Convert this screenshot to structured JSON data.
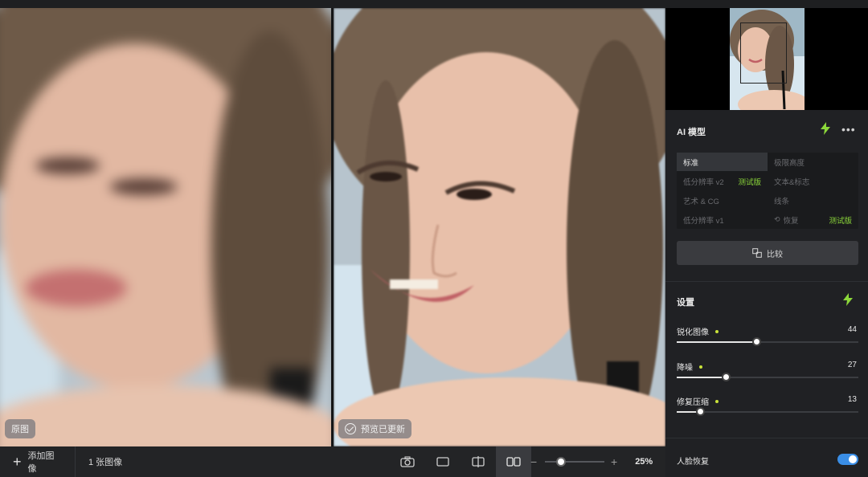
{
  "preview": {
    "left_badge": "原图",
    "right_badge": "预览已更新"
  },
  "toolbar": {
    "add_image": "添加图像",
    "image_count": "1 张图像",
    "zoom_value": "25%"
  },
  "ai_model": {
    "title": "AI 模型",
    "models": [
      {
        "label": "标准",
        "selected": true
      },
      {
        "label": "极限高度",
        "selected": false
      },
      {
        "label": "低分辨率 v2",
        "beta": "测试版",
        "selected": false
      },
      {
        "label": "文本&标志",
        "selected": false
      },
      {
        "label": "艺术 & CG",
        "selected": false
      },
      {
        "label": "线条",
        "selected": false
      },
      {
        "label": "低分辨率 v1",
        "selected": false
      },
      {
        "label": "恢复",
        "beta": "测试版",
        "selected": false
      }
    ],
    "compare_label": "比较"
  },
  "settings": {
    "title": "设置",
    "sliders": [
      {
        "label": "锐化图像",
        "value": 44,
        "fraction": 0.44
      },
      {
        "label": "降噪",
        "value": 27,
        "fraction": 0.27
      },
      {
        "label": "修复压缩",
        "value": 13,
        "fraction": 0.13
      }
    ],
    "face_recovery": "人脸恢复",
    "face_recovery_on": true
  },
  "colors": {
    "accent_green": "#8cd83a",
    "toggle_blue": "#3a8ee6"
  }
}
